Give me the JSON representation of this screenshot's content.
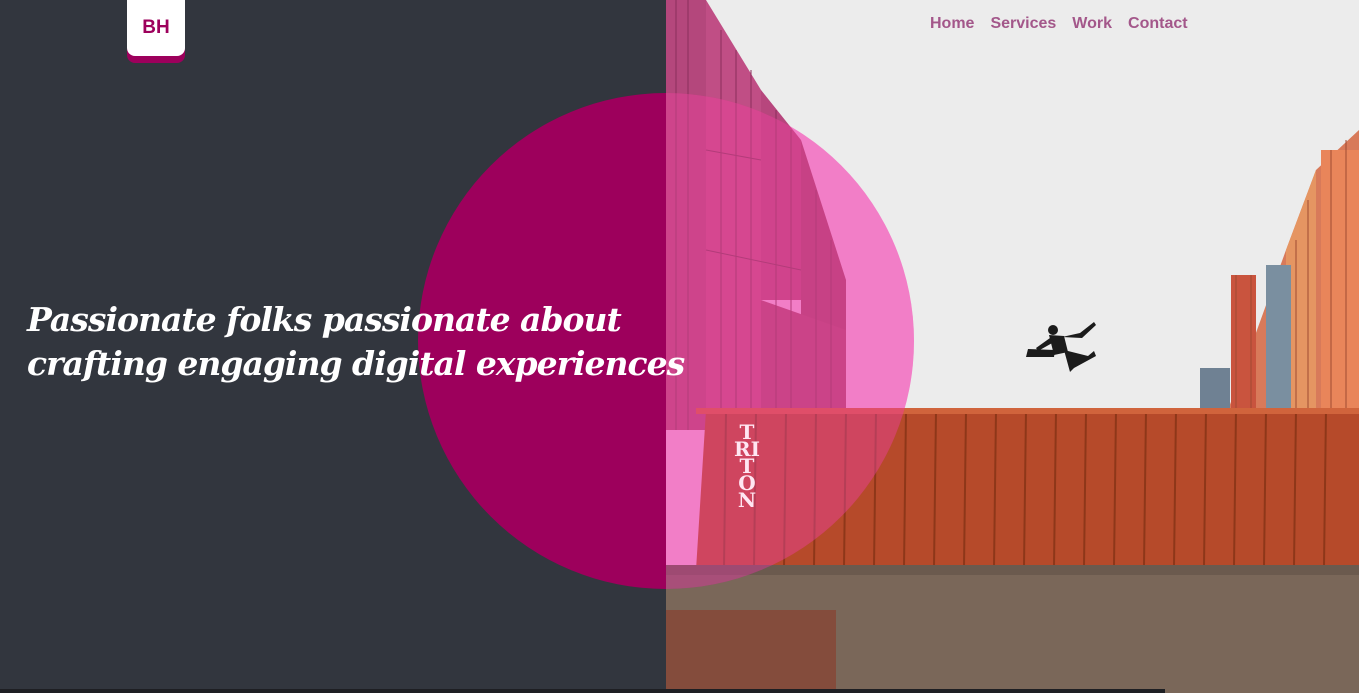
{
  "logo": {
    "text": "BH"
  },
  "nav": {
    "items": [
      {
        "label": "Home"
      },
      {
        "label": "Services"
      },
      {
        "label": "Work"
      },
      {
        "label": "Contact"
      }
    ]
  },
  "hero": {
    "line1": "Passionate folks passionate about",
    "line2": "crafting engaging digital experiences"
  },
  "image": {
    "container_text": "TRITON"
  },
  "colors": {
    "background": "#32363e",
    "accent": "#9d005c",
    "nav_link": "#a3578a"
  }
}
